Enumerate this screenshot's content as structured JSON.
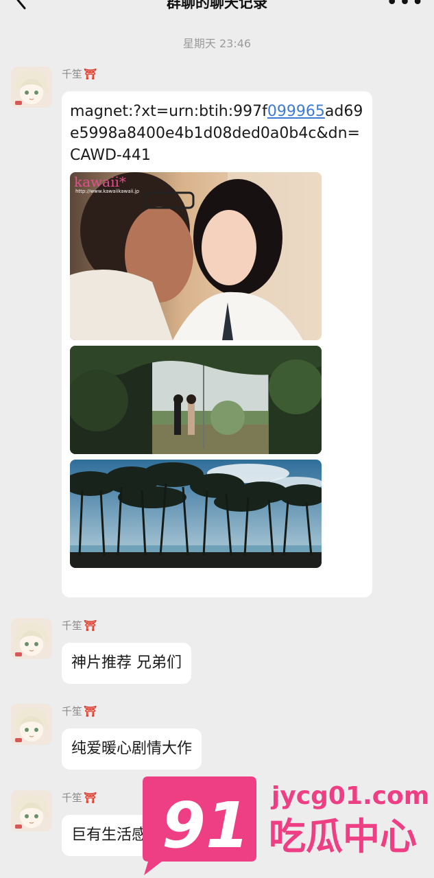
{
  "header": {
    "title": "群聊的聊天记录",
    "back_icon": "chevron-left-icon",
    "more_icon": "more-dots-icon",
    "more_label": "•••"
  },
  "timestamp": "星期天 23:46",
  "messages": [
    {
      "sender": "千笙",
      "sender_emoji": "⛩",
      "magnet_prefix": "magnet:?xt=urn:btih:997f",
      "magnet_link": "099965",
      "magnet_suffix": "ad69e5998a8400e4b1d08ded0a0b4c&dn=CAWD-441",
      "image1_logo": "kawaii*",
      "image1_site": "http://www.kawaiikawaii.jp"
    },
    {
      "sender": "千笙",
      "sender_emoji": "⛩",
      "text": "神片推荐 兄弟们"
    },
    {
      "sender": "千笙",
      "sender_emoji": "⛩",
      "text": "纯爱暖心剧情大作"
    },
    {
      "sender": "千笙",
      "sender_emoji": "⛩",
      "text": "巨有生活感"
    }
  ],
  "watermark": {
    "number": "91",
    "site": "jycg01.com",
    "name": "吃瓜中心"
  },
  "colors": {
    "background": "#ededed",
    "bubble": "#ffffff",
    "link": "#3b7bd6",
    "brand_pink": "#ee3f85"
  }
}
